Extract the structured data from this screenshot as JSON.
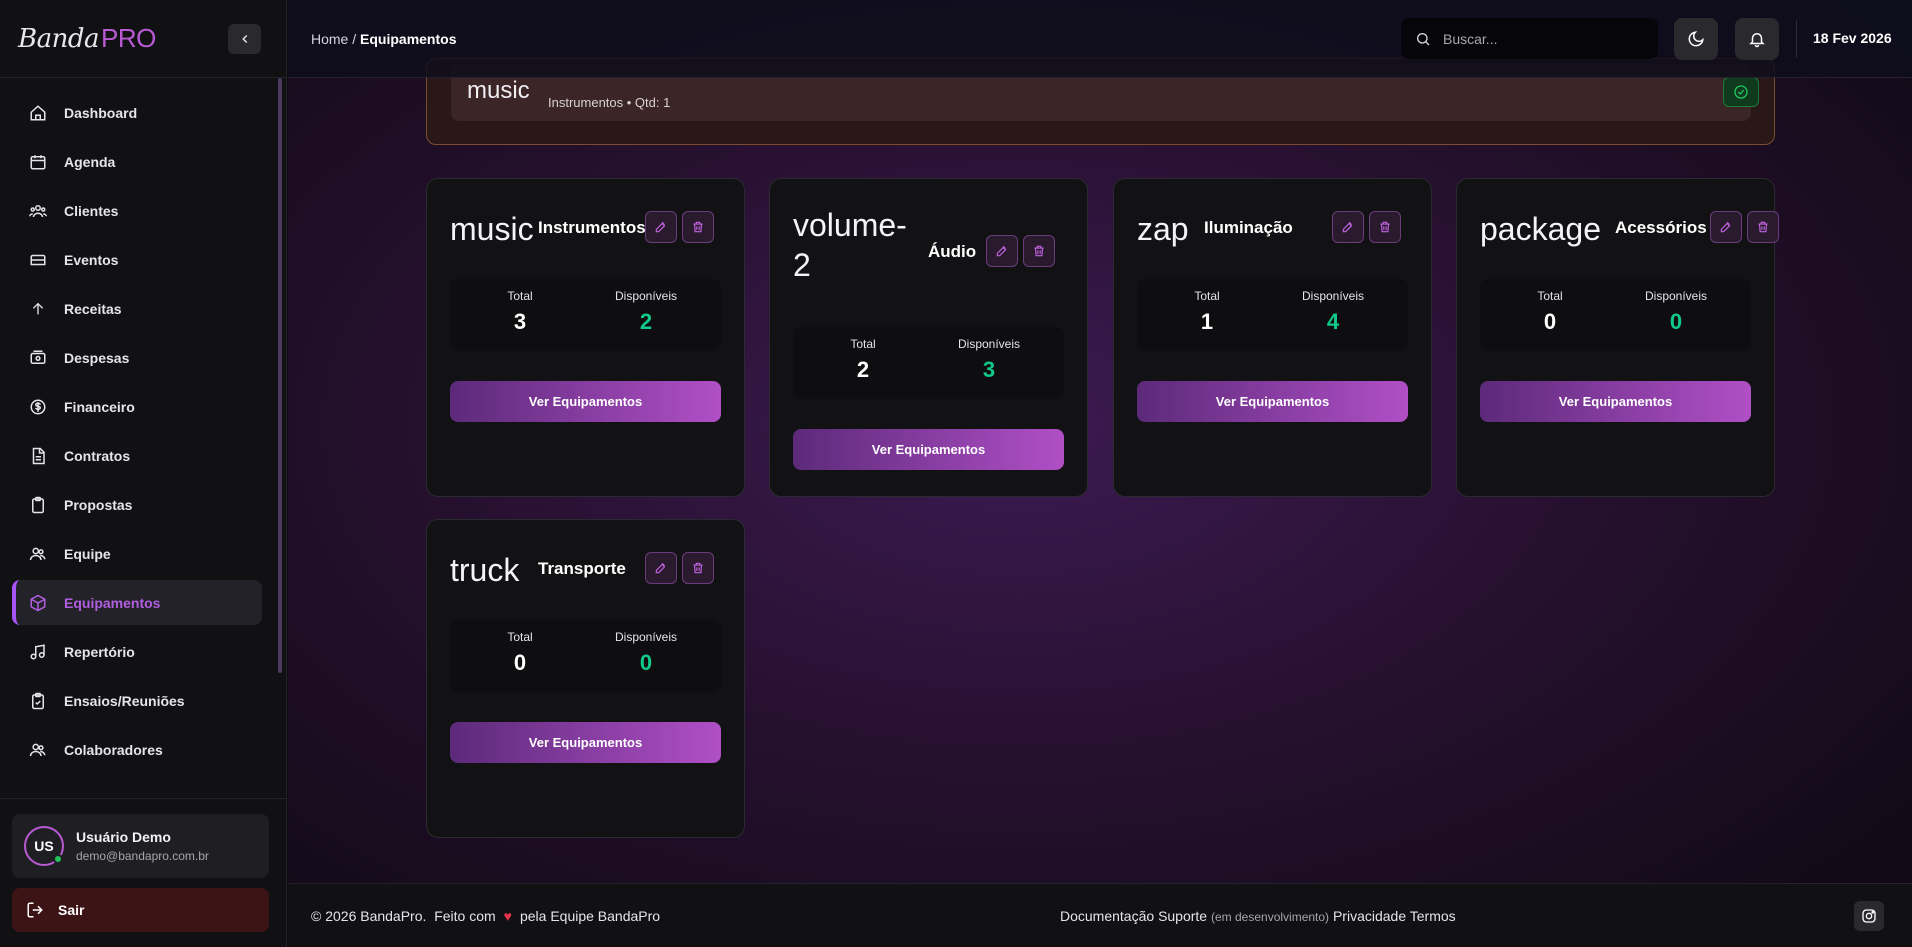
{
  "brand": {
    "logo_script": "Banda",
    "logo_pro": "PRO"
  },
  "sidebar": {
    "items": [
      {
        "label": "Dashboard",
        "icon": "home-icon"
      },
      {
        "label": "Agenda",
        "icon": "calendar-icon"
      },
      {
        "label": "Clientes",
        "icon": "users-icon"
      },
      {
        "label": "Eventos",
        "icon": "ticket-icon"
      },
      {
        "label": "Receitas",
        "icon": "arrow-up-icon"
      },
      {
        "label": "Despesas",
        "icon": "wallet-icon"
      },
      {
        "label": "Financeiro",
        "icon": "dollar-icon"
      },
      {
        "label": "Contratos",
        "icon": "file-icon"
      },
      {
        "label": "Propostas",
        "icon": "clipboard-icon"
      },
      {
        "label": "Equipe",
        "icon": "team-icon"
      },
      {
        "label": "Equipamentos",
        "icon": "box-icon",
        "active": true
      },
      {
        "label": "Repertório",
        "icon": "music-note-icon"
      },
      {
        "label": "Ensaios/Reuniões",
        "icon": "clipboard-check-icon"
      },
      {
        "label": "Colaboradores",
        "icon": "collab-icon"
      }
    ],
    "user": {
      "initials": "US",
      "name": "Usuário Demo",
      "email": "demo@bandapro.com.br"
    },
    "logout_label": "Sair"
  },
  "header": {
    "breadcrumb_home": "Home",
    "breadcrumb_sep": " / ",
    "breadcrumb_current": "Equipamentos",
    "search_placeholder": "Buscar...",
    "date": "18 Fev 2026"
  },
  "banner": {
    "icon_name": "music",
    "subtitle": "Instrumentos • Qtd: 1"
  },
  "cards": [
    {
      "icon_name": "music",
      "title": "Instrumentos",
      "total_label": "Total",
      "total": "3",
      "avail_label": "Disponíveis",
      "avail": "2",
      "button": "Ver Equipamentos"
    },
    {
      "icon_name": "volume-2",
      "title": "Áudio",
      "total_label": "Total",
      "total": "2",
      "avail_label": "Disponíveis",
      "avail": "3",
      "button": "Ver Equipamentos"
    },
    {
      "icon_name": "zap",
      "title": "Iluminação",
      "total_label": "Total",
      "total": "1",
      "avail_label": "Disponíveis",
      "avail": "4",
      "button": "Ver Equipamentos"
    },
    {
      "icon_name": "package",
      "title": "Acessórios",
      "total_label": "Total",
      "total": "0",
      "avail_label": "Disponíveis",
      "avail": "0",
      "button": "Ver Equipamentos"
    },
    {
      "icon_name": "truck",
      "title": "Transporte",
      "total_label": "Total",
      "total": "0",
      "avail_label": "Disponíveis",
      "avail": "0",
      "button": "Ver Equipamentos"
    }
  ],
  "footer": {
    "copyright": "© 2026 BandaPro.",
    "made_with": "Feito com",
    "by_team": "pela Equipe BandaPro",
    "doc": "Documentação",
    "support": "Suporte",
    "in_dev": "(em desenvolvimento)",
    "privacy": "Privacidade",
    "terms": "Termos"
  },
  "colors": {
    "accent": "#a855f7",
    "available": "#10c98a",
    "logout_bg": "#3d1416"
  }
}
